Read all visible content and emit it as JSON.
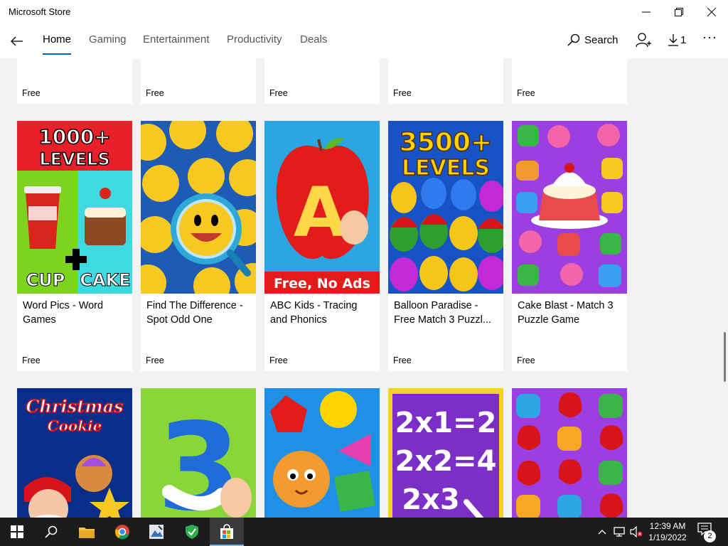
{
  "window": {
    "title": "Microsoft Store"
  },
  "nav": {
    "tabs": [
      "Home",
      "Gaming",
      "Entertainment",
      "Productivity",
      "Deals"
    ],
    "search_label": "Search",
    "downloads_count": "1",
    "more_label": "···"
  },
  "top_row": [
    {
      "price": "Free"
    },
    {
      "price": "Free"
    },
    {
      "price": "Free"
    },
    {
      "price": "Free"
    },
    {
      "price": "Free"
    }
  ],
  "middle_row": [
    {
      "name": "Word Pics - Word Games",
      "price": "Free",
      "tile_text": [
        "1000+",
        "LEVELS",
        "CUP",
        "CAKE"
      ]
    },
    {
      "name": "Find The Difference - Spot Odd One",
      "price": "Free"
    },
    {
      "name": "ABC Kids - Tracing and Phonics",
      "price": "Free",
      "tile_text": [
        "A",
        "Free, No Ads"
      ]
    },
    {
      "name": "Balloon Paradise - Free Match 3 Puzzl...",
      "price": "Free",
      "tile_text": [
        "3500+",
        "LEVELS"
      ]
    },
    {
      "name": "Cake Blast - Match 3 Puzzle Game",
      "price": "Free"
    }
  ],
  "bottom_row": [
    {
      "tile_text": [
        "Christmas",
        "Cookie"
      ]
    },
    {
      "tile_text": [
        "3"
      ]
    },
    {
      "tile_text": []
    },
    {
      "tile_text": [
        "2x1=2",
        "2x2=4",
        "2x3"
      ]
    },
    {
      "tile_text": []
    }
  ],
  "taskbar": {
    "icons": [
      "windows-start-icon",
      "search-icon",
      "file-explorer-icon",
      "chrome-icon",
      "image-app-icon",
      "shield-app-icon",
      "store-icon"
    ],
    "time": "12:39 AM",
    "date": "1/19/2022",
    "notification_count": "2"
  },
  "colors": {
    "accent": "#0067c0",
    "taskbar": "#1c1c1c",
    "background": "#f2f2f2"
  }
}
